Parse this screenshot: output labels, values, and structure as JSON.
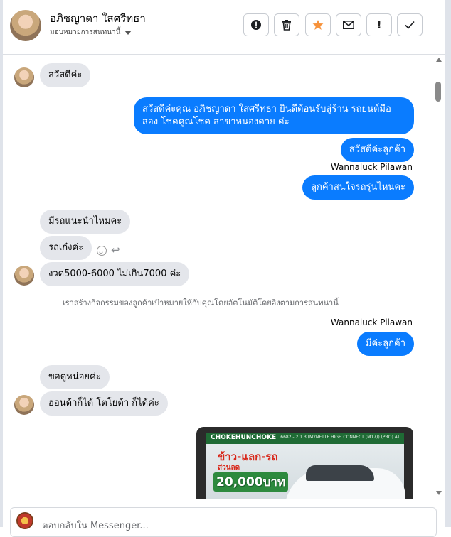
{
  "header": {
    "contact_name": "อภิชญาดา ใสศรีทธา",
    "assign_label": "มอบหมายการสนทนานี้",
    "toolbar": [
      {
        "name": "alert-circle-icon",
        "glyph": "●"
      },
      {
        "name": "trash-icon",
        "glyph": "🗑"
      },
      {
        "name": "star-icon",
        "glyph": "★"
      },
      {
        "name": "mail-icon",
        "glyph": "✉"
      },
      {
        "name": "exclamation-icon",
        "glyph": "!"
      },
      {
        "name": "check-icon",
        "glyph": "✓"
      }
    ]
  },
  "messages": {
    "m1": "สวัสดีค่ะ",
    "m2_line1": "สวัสดีค่ะคุณ อภิชญาดา ใสศรีทธา ยินดีต้อนรับสู่ร้าน รถยนต์มือ",
    "m2_line2": "สอง โชคคูณโชค สาขาหนองคาย ค่ะ",
    "m3": "สวัสดีค่ะลูกค้า",
    "sender1": "Wannaluck Pilawan",
    "m4": "ลูกค้าสนใจรถรุ่นไหนคะ",
    "m5": "มีรถแนะนำไหมคะ",
    "m6": "รถเก๋งค่ะ",
    "m7": "งวด5000-6000 ไม่เกิน7000 ค่ะ",
    "system_note": "เราสร้างกิจกรรมของลูกค้าเป้าหมายให้กับคุณโดยอัตโนมัติโดยอิงตามการสนทนานี้",
    "sender2": "Wannaluck Pilawan",
    "m8": "มีค่ะลูกค้า",
    "m9": "ขอดูหน่อยค่ะ",
    "m10": "ฮอนด้าก็ได้ โตโยต้า ก็ได้ค่ะ"
  },
  "attachment": {
    "banner_text": "CHOKEHUNCHOKE",
    "banner_code": "6682 - 2 1.3 (MYNETTE HIGH CONNECT (M17)) (PRO) AT",
    "promo_line1": "ข้าว-แลก-รถ",
    "promo_line2": "ส่วนลด",
    "promo_amount": "20,000บาท"
  },
  "composer": {
    "placeholder": "ตอบกลับใน Messenger..."
  },
  "colors": {
    "outgoing": "#0a7cff",
    "incoming": "#e4e6eb",
    "star": "#f7923a"
  }
}
